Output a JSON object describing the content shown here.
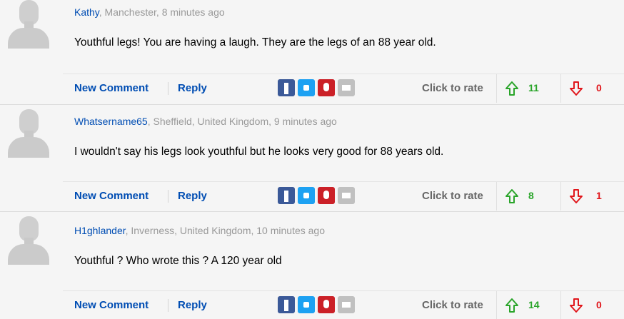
{
  "colors": {
    "link": "#004db3",
    "up": "#2aa52a",
    "down": "#e0161b"
  },
  "labels": {
    "new_comment": "New Comment",
    "reply": "Reply",
    "click_to_rate": "Click to rate"
  },
  "share_icons": [
    "facebook-icon",
    "twitter-icon",
    "pinterest-icon",
    "email-icon"
  ],
  "comments": [
    {
      "username": "Kathy",
      "location_time": ", Manchester, 8 minutes ago",
      "text": "Youthful legs! You are having a laugh. They are the legs of an 88 year old.",
      "upvotes": "11",
      "downvotes": "0"
    },
    {
      "username": "Whatsername65",
      "location_time": ", Sheffield, United Kingdom, 9 minutes ago",
      "text": "I wouldn't say his legs look youthful but he looks very good for 88 years old.",
      "upvotes": "8",
      "downvotes": "1"
    },
    {
      "username": "H1ghlander",
      "location_time": ", Inverness, United Kingdom, 10 minutes ago",
      "text": "Youthful ? Who wrote this ? A 120 year old",
      "upvotes": "14",
      "downvotes": "0"
    }
  ]
}
